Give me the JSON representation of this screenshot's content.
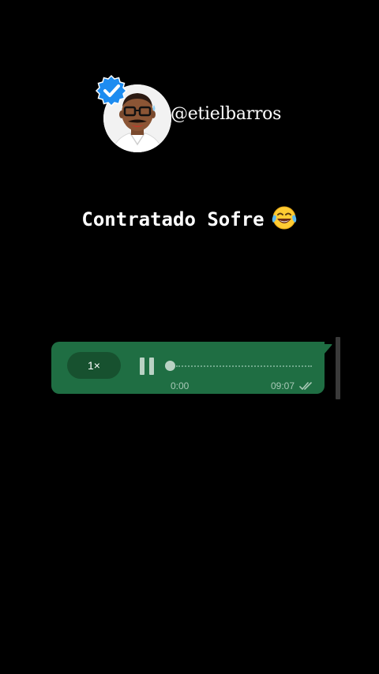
{
  "profile": {
    "handle": "@etielbarros",
    "verified_icon": "verified-badge-icon",
    "avatar_icon": "cartoon-avatar"
  },
  "caption": {
    "text": "Contratado Sofre",
    "emoji": "tears-of-joy-emoji"
  },
  "voice_message": {
    "speed_label": "1×",
    "state": "playing",
    "current_time": "0:00",
    "sent_time": "09:07",
    "progress": 0,
    "read_status": "double-check-icon"
  },
  "colors": {
    "background": "#000000",
    "bubble": "#1f6e43",
    "speed_pill": "#17512f",
    "verified": "#1d8cf0"
  }
}
